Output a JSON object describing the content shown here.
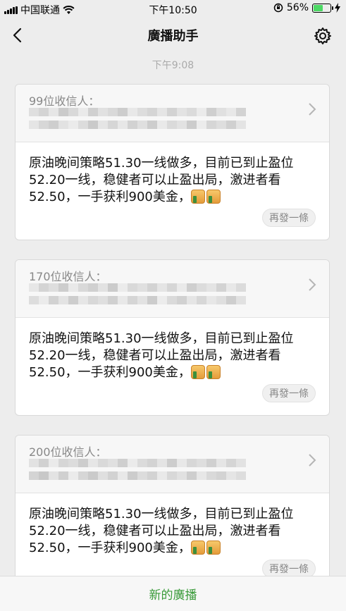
{
  "status_bar": {
    "carrier": "中国联通",
    "time": "下午10:50",
    "battery_percent": "56%",
    "battery_level": 0.56
  },
  "nav": {
    "title": "廣播助手"
  },
  "timestamp": "下午9:08",
  "broadcasts": [
    {
      "recipients": "99位收信人：",
      "message": "原油晚间策略51.30一线做多，目前已到止盈位52.20一线，稳健者可以止盈出局，激进者看52.50，一手获利900美金，",
      "resend_label": "再發一條"
    },
    {
      "recipients": "170位收信人：",
      "message": "原油晚间策略51.30一线做多，目前已到止盈位52.20一线，稳健者可以止盈出局，激进者看52.50，一手获利900美金，",
      "resend_label": "再發一條"
    },
    {
      "recipients": "200位收信人：",
      "message": "原油晚间策略51.30一线做多，目前已到止盈位52.20一线，稳健者可以止盈出局，激进者看52.50，一手获利900美金，",
      "resend_label": "再發一條"
    }
  ],
  "bottom": {
    "new_broadcast_label": "新的廣播"
  },
  "colors": {
    "accent_green": "#3a9b3a",
    "background": "#ededed"
  },
  "icons": [
    "back-icon",
    "gear-icon",
    "chevron-right-icon",
    "thumbs-up-icon"
  ]
}
